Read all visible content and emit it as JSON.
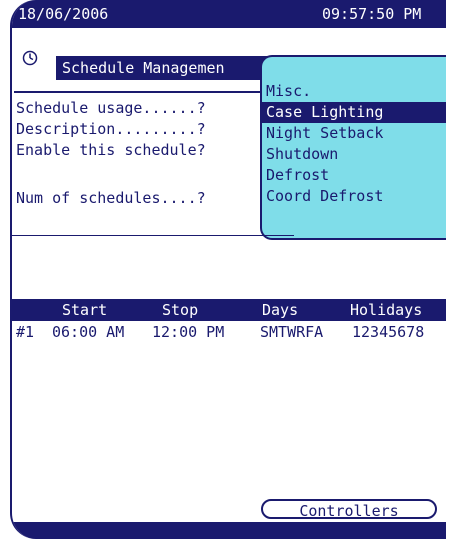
{
  "status_bar": {
    "date": "18/06/2006",
    "time": "09:57:50 PM"
  },
  "header": {
    "title": "Schedule Managemen",
    "icon": "clock-icon"
  },
  "fields": [
    {
      "label": "Schedule usage......?"
    },
    {
      "label": "Description.........?"
    },
    {
      "label": "Enable this schedule?"
    },
    {
      "label": "Num of schedules....?"
    }
  ],
  "popup": {
    "options": [
      "Misc.",
      "Case Lighting",
      "Night Setback",
      "Shutdown",
      "Defrost",
      "Coord Defrost"
    ],
    "selected": "Case Lighting"
  },
  "table": {
    "headers": {
      "start": "Start",
      "stop": "Stop",
      "days": "Days",
      "holidays": "Holidays"
    },
    "rows": [
      {
        "num": "#1",
        "start": "06:00 AM",
        "stop": "12:00 PM",
        "days": "SMTWRFA",
        "holidays": "12345678"
      }
    ]
  },
  "buttons": {
    "controllers": "Controllers"
  },
  "colors": {
    "primary": "#1a1a6e",
    "popup_bg": "#7fdde9",
    "background": "#ffffff"
  }
}
